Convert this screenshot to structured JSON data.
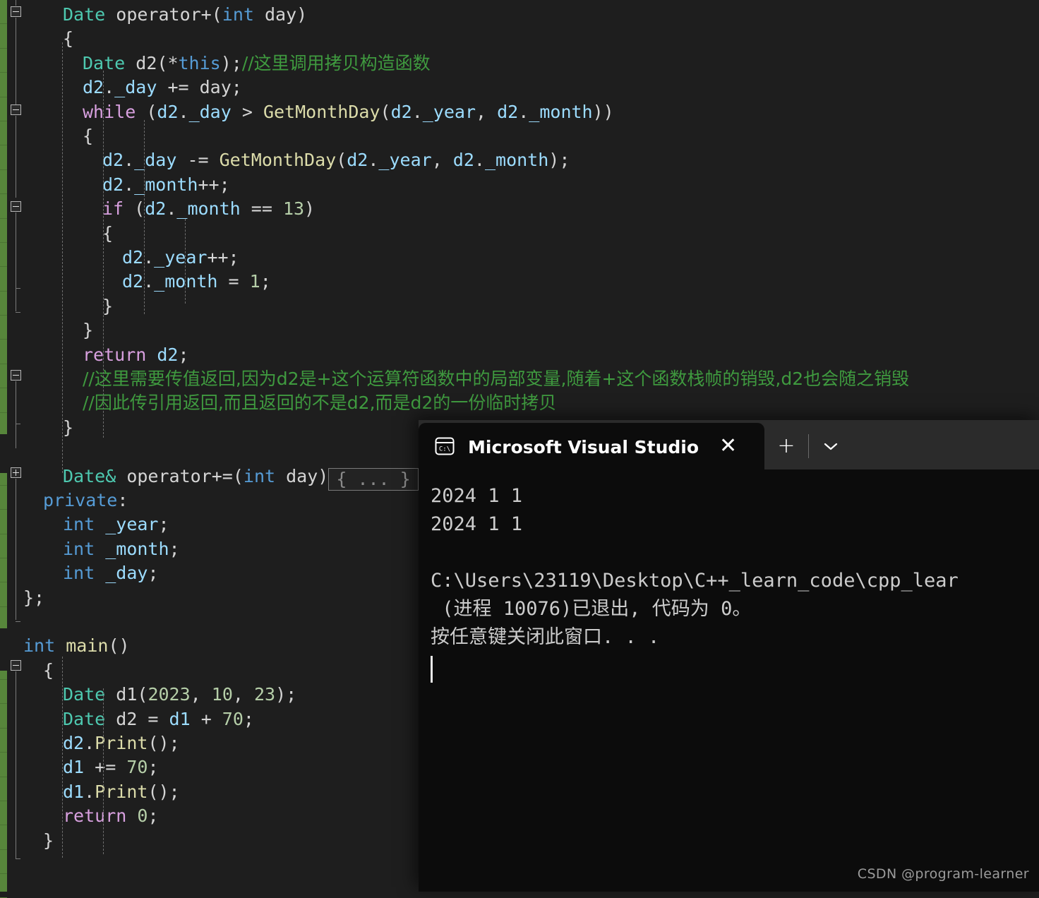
{
  "editor": {
    "name": "visual-studio-code-editor",
    "background": "#1e1e1e",
    "change_bar_color": "#57863b",
    "code_lines": [
      {
        "indent": 0,
        "tokens": [
          {
            "c": "t-type",
            "s": "Date"
          },
          {
            "c": "t-plain",
            "s": " operator+"
          },
          {
            "c": "t-punct",
            "s": "("
          },
          {
            "c": "t-kw2",
            "s": "int"
          },
          {
            "c": "t-plain",
            "s": " day"
          },
          {
            "c": "t-punct",
            "s": ")"
          }
        ]
      },
      {
        "indent": 0,
        "tokens": [
          {
            "c": "t-punct",
            "s": "{"
          }
        ]
      },
      {
        "indent": 1,
        "tokens": [
          {
            "c": "t-type",
            "s": "Date"
          },
          {
            "c": "t-plain",
            "s": " d2"
          },
          {
            "c": "t-punct",
            "s": "("
          },
          {
            "c": "t-plain",
            "s": "*"
          },
          {
            "c": "t-kw2",
            "s": "this"
          },
          {
            "c": "t-punct",
            "s": ");"
          },
          {
            "c": "t-cmt",
            "s": "//这里调用拷贝构造函数"
          }
        ]
      },
      {
        "indent": 1,
        "tokens": [
          {
            "c": "t-var",
            "s": "d2"
          },
          {
            "c": "t-punct",
            "s": "."
          },
          {
            "c": "t-var",
            "s": "_day"
          },
          {
            "c": "t-plain",
            "s": " += day;"
          }
        ]
      },
      {
        "indent": 1,
        "tokens": [
          {
            "c": "t-kw",
            "s": "while"
          },
          {
            "c": "t-plain",
            "s": " "
          },
          {
            "c": "t-punct",
            "s": "("
          },
          {
            "c": "t-var",
            "s": "d2"
          },
          {
            "c": "t-punct",
            "s": "."
          },
          {
            "c": "t-var",
            "s": "_day"
          },
          {
            "c": "t-plain",
            "s": " > "
          },
          {
            "c": "t-fn",
            "s": "GetMonthDay"
          },
          {
            "c": "t-punct",
            "s": "("
          },
          {
            "c": "t-var",
            "s": "d2"
          },
          {
            "c": "t-punct",
            "s": "."
          },
          {
            "c": "t-var",
            "s": "_year"
          },
          {
            "c": "t-plain",
            "s": ", "
          },
          {
            "c": "t-var",
            "s": "d2"
          },
          {
            "c": "t-punct",
            "s": "."
          },
          {
            "c": "t-var",
            "s": "_month"
          },
          {
            "c": "t-punct",
            "s": "))"
          }
        ]
      },
      {
        "indent": 1,
        "tokens": [
          {
            "c": "t-punct",
            "s": "{"
          }
        ]
      },
      {
        "indent": 2,
        "tokens": [
          {
            "c": "t-var",
            "s": "d2"
          },
          {
            "c": "t-punct",
            "s": "."
          },
          {
            "c": "t-var",
            "s": "_day"
          },
          {
            "c": "t-plain",
            "s": " -= "
          },
          {
            "c": "t-fn",
            "s": "GetMonthDay"
          },
          {
            "c": "t-punct",
            "s": "("
          },
          {
            "c": "t-var",
            "s": "d2"
          },
          {
            "c": "t-punct",
            "s": "."
          },
          {
            "c": "t-var",
            "s": "_year"
          },
          {
            "c": "t-plain",
            "s": ", "
          },
          {
            "c": "t-var",
            "s": "d2"
          },
          {
            "c": "t-punct",
            "s": "."
          },
          {
            "c": "t-var",
            "s": "_month"
          },
          {
            "c": "t-punct",
            "s": ");"
          }
        ]
      },
      {
        "indent": 2,
        "tokens": [
          {
            "c": "t-var",
            "s": "d2"
          },
          {
            "c": "t-punct",
            "s": "."
          },
          {
            "c": "t-var",
            "s": "_month"
          },
          {
            "c": "t-plain",
            "s": "++;"
          }
        ]
      },
      {
        "indent": 2,
        "tokens": [
          {
            "c": "t-kw",
            "s": "if"
          },
          {
            "c": "t-plain",
            "s": " "
          },
          {
            "c": "t-punct",
            "s": "("
          },
          {
            "c": "t-var",
            "s": "d2"
          },
          {
            "c": "t-punct",
            "s": "."
          },
          {
            "c": "t-var",
            "s": "_month"
          },
          {
            "c": "t-plain",
            "s": " == "
          },
          {
            "c": "t-num",
            "s": "13"
          },
          {
            "c": "t-punct",
            "s": ")"
          }
        ]
      },
      {
        "indent": 2,
        "tokens": [
          {
            "c": "t-punct",
            "s": "{"
          }
        ]
      },
      {
        "indent": 3,
        "tokens": [
          {
            "c": "t-var",
            "s": "d2"
          },
          {
            "c": "t-punct",
            "s": "."
          },
          {
            "c": "t-var",
            "s": "_year"
          },
          {
            "c": "t-plain",
            "s": "++;"
          }
        ]
      },
      {
        "indent": 3,
        "tokens": [
          {
            "c": "t-var",
            "s": "d2"
          },
          {
            "c": "t-punct",
            "s": "."
          },
          {
            "c": "t-var",
            "s": "_month"
          },
          {
            "c": "t-plain",
            "s": " = "
          },
          {
            "c": "t-num",
            "s": "1"
          },
          {
            "c": "t-punct",
            "s": ";"
          }
        ]
      },
      {
        "indent": 2,
        "tokens": [
          {
            "c": "t-punct",
            "s": "}"
          }
        ]
      },
      {
        "indent": 1,
        "tokens": [
          {
            "c": "t-punct",
            "s": "}"
          }
        ]
      },
      {
        "indent": 1,
        "tokens": [
          {
            "c": "t-kw",
            "s": "return"
          },
          {
            "c": "t-plain",
            "s": " "
          },
          {
            "c": "t-var",
            "s": "d2"
          },
          {
            "c": "t-punct",
            "s": ";"
          }
        ]
      },
      {
        "indent": 1,
        "tokens": [
          {
            "c": "t-cmt",
            "s": "//这里需要传值返回,因为d2是+这个运算符函数中的局部变量,随着+这个函数栈帧的销毁,d2也会随之销毁"
          }
        ]
      },
      {
        "indent": 1,
        "tokens": [
          {
            "c": "t-cmt",
            "s": "//因此传引用返回,而且返回的不是d2,而是d2的一份临时拷贝"
          }
        ]
      },
      {
        "indent": 0,
        "tokens": [
          {
            "c": "t-punct",
            "s": "}"
          }
        ]
      },
      {
        "indent": 0,
        "tokens": []
      },
      {
        "indent": 0,
        "collapsed": true,
        "collapsed_label": "{ ... }",
        "tokens": [
          {
            "c": "t-type",
            "s": "Date&"
          },
          {
            "c": "t-plain",
            "s": " operator+="
          },
          {
            "c": "t-punct",
            "s": "("
          },
          {
            "c": "t-kw2",
            "s": "int"
          },
          {
            "c": "t-plain",
            "s": " day"
          },
          {
            "c": "t-punct",
            "s": ")"
          }
        ]
      },
      {
        "indent": -1,
        "tokens": [
          {
            "c": "t-kw2",
            "s": "private"
          },
          {
            "c": "t-punct",
            "s": ":"
          }
        ]
      },
      {
        "indent": 0,
        "tokens": [
          {
            "c": "t-kw2",
            "s": "int"
          },
          {
            "c": "t-plain",
            "s": " "
          },
          {
            "c": "t-var",
            "s": "_year"
          },
          {
            "c": "t-punct",
            "s": ";"
          }
        ]
      },
      {
        "indent": 0,
        "tokens": [
          {
            "c": "t-kw2",
            "s": "int"
          },
          {
            "c": "t-plain",
            "s": " "
          },
          {
            "c": "t-var",
            "s": "_month"
          },
          {
            "c": "t-punct",
            "s": ";"
          }
        ]
      },
      {
        "indent": 0,
        "tokens": [
          {
            "c": "t-kw2",
            "s": "int"
          },
          {
            "c": "t-plain",
            "s": " "
          },
          {
            "c": "t-var",
            "s": "_day"
          },
          {
            "c": "t-punct",
            "s": ";"
          }
        ]
      },
      {
        "indent": -2,
        "tokens": [
          {
            "c": "t-punct",
            "s": "};"
          }
        ]
      },
      {
        "indent": 0,
        "tokens": []
      },
      {
        "indent": -2,
        "tokens": [
          {
            "c": "t-kw2",
            "s": "int"
          },
          {
            "c": "t-plain",
            "s": " "
          },
          {
            "c": "t-fn",
            "s": "main"
          },
          {
            "c": "t-punct",
            "s": "()"
          }
        ]
      },
      {
        "indent": -1,
        "tokens": [
          {
            "c": "t-punct",
            "s": "{"
          }
        ]
      },
      {
        "indent": 0,
        "tokens": [
          {
            "c": "t-type",
            "s": "Date"
          },
          {
            "c": "t-plain",
            "s": " d1"
          },
          {
            "c": "t-punct",
            "s": "("
          },
          {
            "c": "t-num",
            "s": "2023"
          },
          {
            "c": "t-plain",
            "s": ", "
          },
          {
            "c": "t-num",
            "s": "10"
          },
          {
            "c": "t-plain",
            "s": ", "
          },
          {
            "c": "t-num",
            "s": "23"
          },
          {
            "c": "t-punct",
            "s": ");"
          }
        ]
      },
      {
        "indent": 0,
        "tokens": [
          {
            "c": "t-type",
            "s": "Date"
          },
          {
            "c": "t-plain",
            "s": " d2 = "
          },
          {
            "c": "t-var",
            "s": "d1"
          },
          {
            "c": "t-plain",
            "s": " + "
          },
          {
            "c": "t-num",
            "s": "70"
          },
          {
            "c": "t-punct",
            "s": ";"
          }
        ]
      },
      {
        "indent": 0,
        "tokens": [
          {
            "c": "t-var",
            "s": "d2"
          },
          {
            "c": "t-punct",
            "s": "."
          },
          {
            "c": "t-fn",
            "s": "Print"
          },
          {
            "c": "t-punct",
            "s": "();"
          }
        ]
      },
      {
        "indent": 0,
        "tokens": [
          {
            "c": "t-var",
            "s": "d1"
          },
          {
            "c": "t-plain",
            "s": " += "
          },
          {
            "c": "t-num",
            "s": "70"
          },
          {
            "c": "t-punct",
            "s": ";"
          }
        ]
      },
      {
        "indent": 0,
        "tokens": [
          {
            "c": "t-var",
            "s": "d1"
          },
          {
            "c": "t-punct",
            "s": "."
          },
          {
            "c": "t-fn",
            "s": "Print"
          },
          {
            "c": "t-punct",
            "s": "();"
          }
        ]
      },
      {
        "indent": 0,
        "tokens": [
          {
            "c": "t-kw",
            "s": "return"
          },
          {
            "c": "t-plain",
            "s": " "
          },
          {
            "c": "t-num",
            "s": "0"
          },
          {
            "c": "t-punct",
            "s": ";"
          }
        ]
      },
      {
        "indent": -1,
        "tokens": [
          {
            "c": "t-punct",
            "s": "}"
          }
        ]
      }
    ]
  },
  "terminal": {
    "name": "microsoft-visual-studio-debug-console",
    "tab_title": "Microsoft Visual Studio 调试控",
    "tab_icon": "console-icon",
    "close_label": "✕",
    "new_tab_label": "+",
    "dropdown_label": "⌄",
    "background": "#0c0c0c",
    "tabbar_background": "#2b2b2b",
    "output_lines": [
      "2024 1 1",
      "2024 1 1",
      "",
      "C:\\Users\\23119\\Desktop\\C++_learn_code\\cpp_lear",
      " (进程 10076)已退出, 代码为 0。",
      "按任意键关闭此窗口. . ."
    ]
  },
  "watermark": {
    "text": "CSDN @program-learner"
  }
}
